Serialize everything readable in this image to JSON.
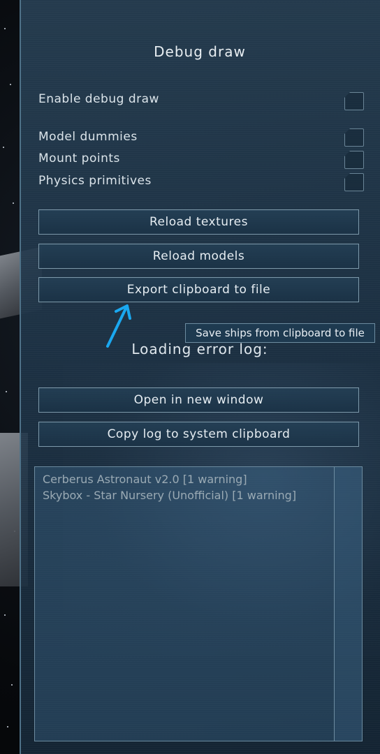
{
  "panel": {
    "title": "Debug draw",
    "enable_debug_draw_label": "Enable debug draw",
    "options": [
      {
        "label": "Model dummies"
      },
      {
        "label": "Mount points"
      },
      {
        "label": "Physics primitives"
      }
    ],
    "buttons": {
      "reload_textures": "Reload textures",
      "reload_models": "Reload models",
      "export_clipboard": "Export clipboard to file",
      "open_new_window": "Open in new window",
      "copy_log": "Copy log to system clipboard"
    },
    "tooltip": "Save ships from clipboard to file",
    "loading_error_log_label": "Loading error log:",
    "log_entries": [
      "Cerberus Astronaut v2.0 [1 warning]",
      "Skybox - Star Nursery (Unofficial) [1 warning]"
    ]
  },
  "colors": {
    "panel_bg": "#264052",
    "accent_arrow": "#1aa8f0",
    "button_border": "#7e9aab",
    "text": "#e6edf2"
  },
  "icons": {
    "annotation_arrow": "arrow-up-icon"
  }
}
